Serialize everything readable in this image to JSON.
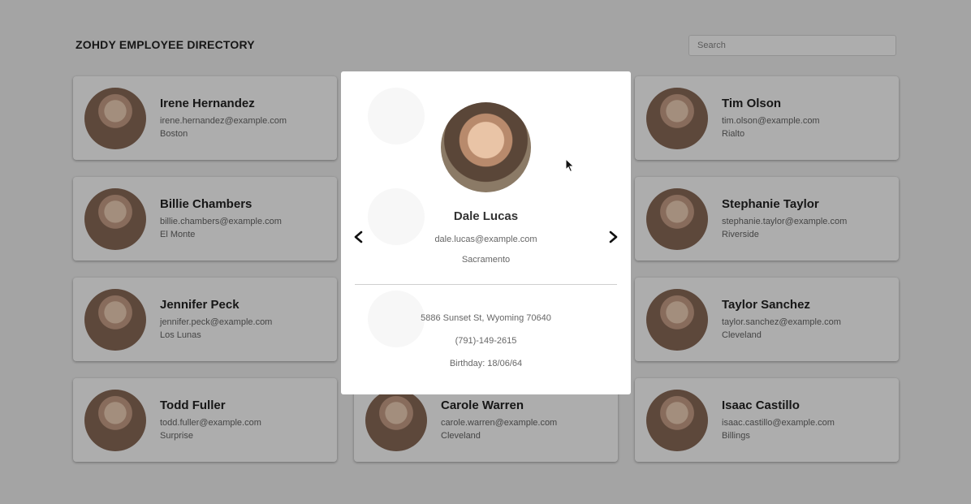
{
  "header": {
    "title": "ZOHDY EMPLOYEE DIRECTORY"
  },
  "search": {
    "placeholder": "Search"
  },
  "employees": [
    {
      "name": "Irene Hernandez",
      "email": "irene.hernandez@example.com",
      "city": "Boston"
    },
    {
      "name": "",
      "email": "",
      "city": ""
    },
    {
      "name": "Tim Olson",
      "email": "tim.olson@example.com",
      "city": "Rialto"
    },
    {
      "name": "Billie Chambers",
      "email": "billie.chambers@example.com",
      "city": "El Monte"
    },
    {
      "name": "",
      "email": "",
      "city": ""
    },
    {
      "name": "Stephanie Taylor",
      "email": "stephanie.taylor@example.com",
      "city": "Riverside"
    },
    {
      "name": "Jennifer Peck",
      "email": "jennifer.peck@example.com",
      "city": "Los Lunas"
    },
    {
      "name": "",
      "email": "",
      "city": ""
    },
    {
      "name": "Taylor Sanchez",
      "email": "taylor.sanchez@example.com",
      "city": "Cleveland"
    },
    {
      "name": "Todd Fuller",
      "email": "todd.fuller@example.com",
      "city": "Surprise"
    },
    {
      "name": "Carole Warren",
      "email": "carole.warren@example.com",
      "city": "Cleveland"
    },
    {
      "name": "Isaac Castillo",
      "email": "isaac.castillo@example.com",
      "city": "Billings"
    }
  ],
  "modal": {
    "name": "Dale Lucas",
    "email": "dale.lucas@example.com",
    "city": "Sacramento",
    "address": "5886 Sunset St, Wyoming 70640",
    "phone": "(791)-149-2615",
    "birthday": "Birthday: 18/06/64",
    "prev_icon": "chevron-left-icon",
    "next_icon": "chevron-right-icon"
  },
  "colors": {
    "overlay": "rgba(0,0,0,0.32)",
    "background": "#f2f2f2",
    "card": "#ffffff"
  }
}
